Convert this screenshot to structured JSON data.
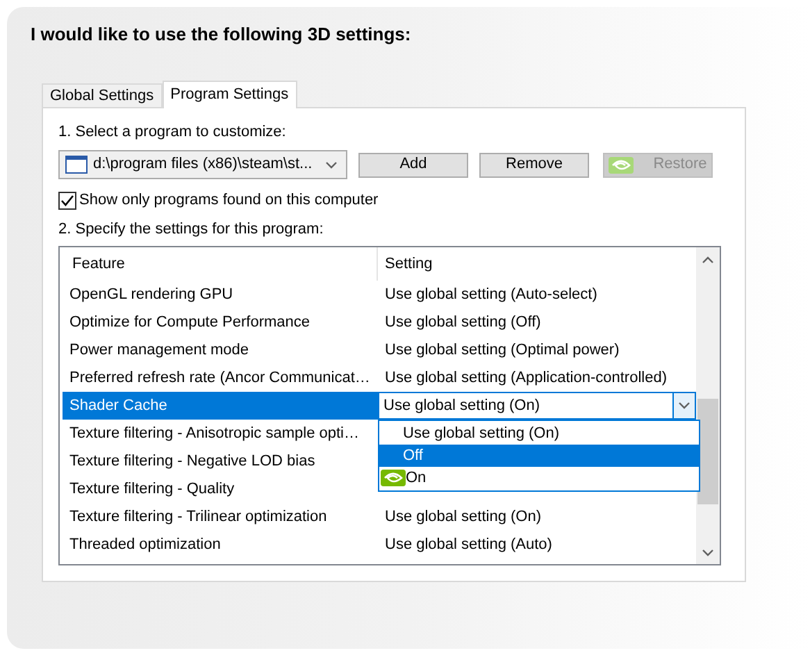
{
  "heading": "I would like to use the following 3D settings:",
  "tabs": [
    {
      "label": "Global Settings",
      "selected": false
    },
    {
      "label": "Program Settings",
      "selected": true
    }
  ],
  "step_1": "1. Select a program to customize:",
  "program_select": {
    "value": "d:\\program files (x86)\\steam\\st..."
  },
  "buttons": [
    {
      "label": "Add",
      "disabled": false,
      "kind": "plain"
    },
    {
      "label": "Remove",
      "disabled": false,
      "kind": "plain"
    },
    {
      "label": "Restore",
      "disabled": true,
      "kind": "logo"
    }
  ],
  "show_only_found": {
    "label": "Show only programs found on this computer",
    "checked": true
  },
  "step_2": "2. Specify the settings for this program:",
  "table": {
    "columns": [
      "Feature",
      "Setting"
    ],
    "rows": [
      {
        "feature": "OpenGL rendering GPU",
        "setting": "Use global setting (Auto-select)",
        "selected": false
      },
      {
        "feature": "Optimize for Compute Performance",
        "setting": "Use global setting (Off)",
        "selected": false
      },
      {
        "feature": "Power management mode",
        "setting": "Use global setting (Optimal power)",
        "selected": false
      },
      {
        "feature": "Preferred refresh rate (Ancor Communicat…",
        "setting": "Use global setting (Application-controlled)",
        "selected": false
      },
      {
        "feature": "Shader Cache",
        "setting": "Use global setting (On)",
        "selected": true,
        "options": [
          {
            "label": "Use global setting (On)",
            "selected": false,
            "logo": false
          },
          {
            "label": "Off",
            "selected": true,
            "logo": false
          },
          {
            "label": "On",
            "selected": false,
            "logo": true
          }
        ]
      },
      {
        "feature": "Texture filtering - Anisotropic sample opti…",
        "selected": false
      },
      {
        "feature": "Texture filtering - Negative LOD bias",
        "selected": false
      },
      {
        "feature": "Texture filtering - Quality",
        "selected": false
      },
      {
        "feature": "Texture filtering - Trilinear optimization",
        "setting": "Use global setting (On)",
        "selected": false
      },
      {
        "feature": "Threaded optimization",
        "setting": "Use global setting (Auto)",
        "selected": false
      }
    ]
  }
}
